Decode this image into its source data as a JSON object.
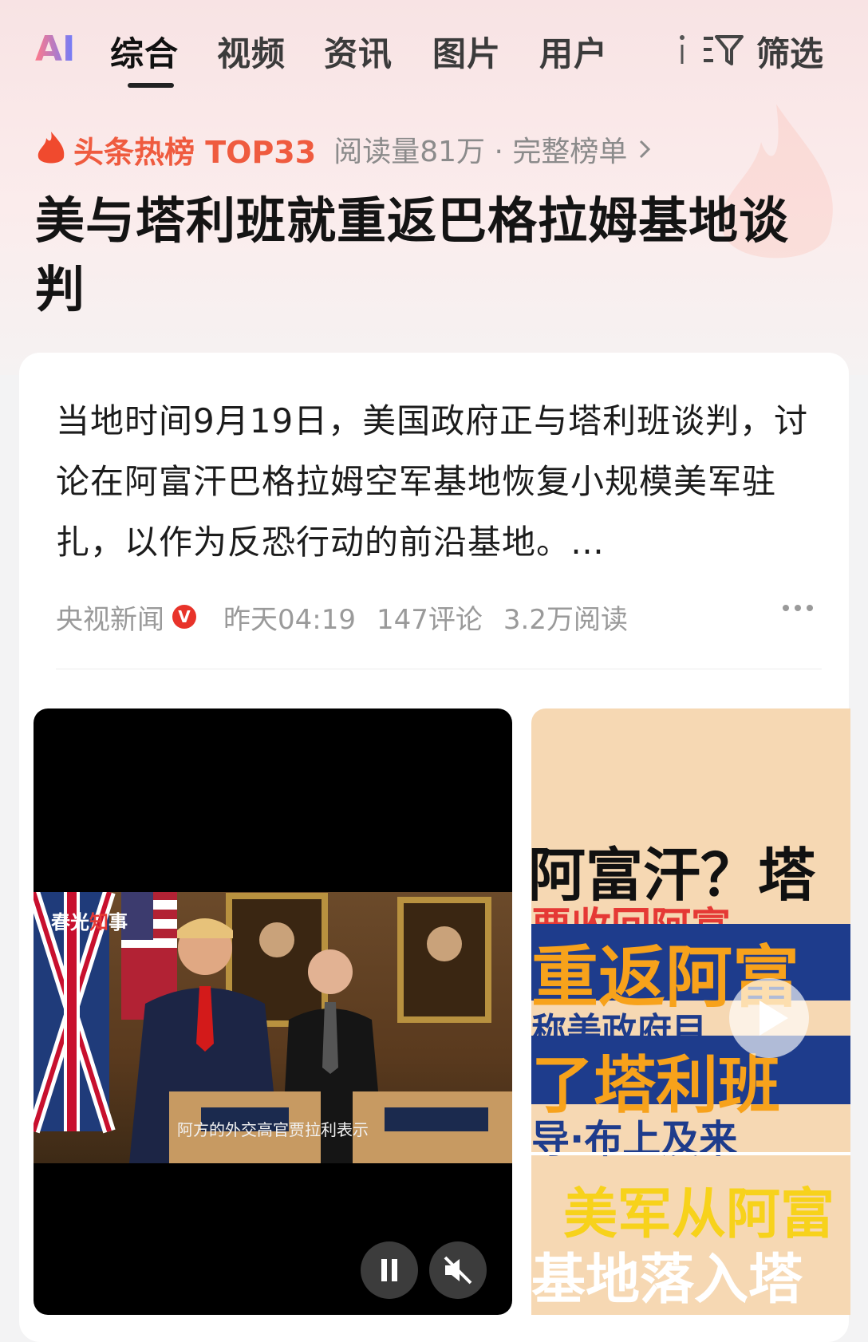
{
  "tabs": {
    "ai_label": "AI",
    "items": [
      "综合",
      "视频",
      "资讯",
      "图片",
      "用户"
    ],
    "filter_label": "筛选"
  },
  "hot": {
    "label": "头条热榜 TOP33",
    "meta": "阅读量81万 · 完整榜单"
  },
  "headline": "美与塔利班就重返巴格拉姆基地谈判",
  "article": {
    "summary": "当地时间9月19日，美国政府正与塔利班谈判，讨论在阿富汗巴格拉姆空军基地恢复小规模美军驻扎，以作为反恐行动的前沿基地。…",
    "source": "央视新闻",
    "verified": "V",
    "time": "昨天04:19",
    "comments": "147评论",
    "reads": "3.2万阅读"
  },
  "video1": {
    "watermark_a": "春光",
    "watermark_b": "知",
    "watermark_c": "事",
    "subtitle": "阿方的外交高官贾拉利表示"
  },
  "video2": {
    "line1": "阿富汗？塔",
    "line2": "要收回阿富",
    "line3": "重返阿富",
    "line4": "称美政府目",
    "line5": "了塔利班",
    "line6": "导·布上及来",
    "line7": "美军从阿富",
    "line8": "基地落入塔"
  },
  "colors": {
    "accent_red": "#ef5b3f",
    "verified_red": "#e8332a"
  }
}
